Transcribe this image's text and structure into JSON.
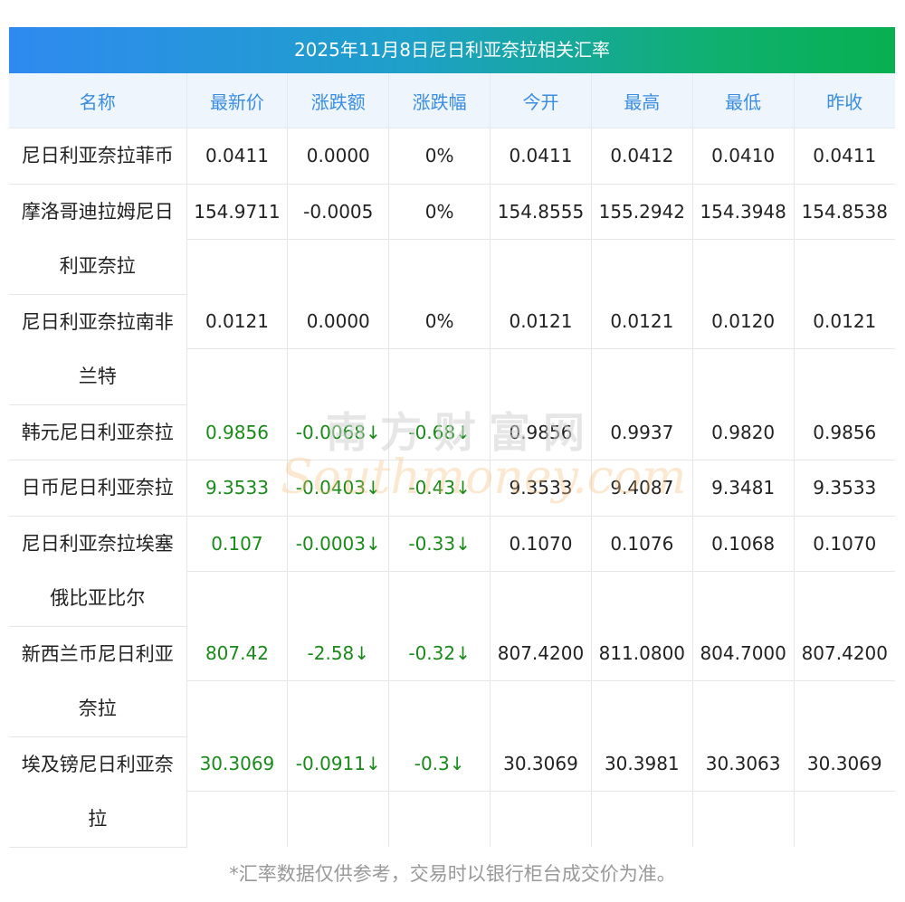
{
  "title": "2025年11月8日尼日利亚奈拉相关汇率",
  "headers": [
    "名称",
    "最新价",
    "涨跌额",
    "涨跌幅",
    "今开",
    "最高",
    "最低",
    "昨收"
  ],
  "rows": [
    {
      "name": "尼日利亚奈拉菲币",
      "latest": "0.0411",
      "change": "0.0000",
      "pct": "0%",
      "open": "0.0411",
      "high": "0.0412",
      "low": "0.0410",
      "prev": "0.0411",
      "green": false,
      "tall": false
    },
    {
      "name": "摩洛哥迪拉姆尼日利亚奈拉",
      "latest": "154.9711",
      "change": "-0.0005",
      "pct": "0%",
      "open": "154.8555",
      "high": "155.2942",
      "low": "154.3948",
      "prev": "154.8538",
      "green": false,
      "tall": true
    },
    {
      "name": "尼日利亚奈拉南非兰特",
      "latest": "0.0121",
      "change": "0.0000",
      "pct": "0%",
      "open": "0.0121",
      "high": "0.0121",
      "low": "0.0120",
      "prev": "0.0121",
      "green": false,
      "tall": true
    },
    {
      "name": "韩元尼日利亚奈拉",
      "latest": "0.9856",
      "change": "-0.0068↓",
      "pct": "-0.68↓",
      "open": "0.9856",
      "high": "0.9937",
      "low": "0.9820",
      "prev": "0.9856",
      "green": true,
      "tall": false
    },
    {
      "name": "日币尼日利亚奈拉",
      "latest": "9.3533",
      "change": "-0.0403↓",
      "pct": "-0.43↓",
      "open": "9.3533",
      "high": "9.4087",
      "low": "9.3481",
      "prev": "9.3533",
      "green": true,
      "tall": false
    },
    {
      "name": "尼日利亚奈拉埃塞俄比亚比尔",
      "latest": "0.107",
      "change": "-0.0003↓",
      "pct": "-0.33↓",
      "open": "0.1070",
      "high": "0.1076",
      "low": "0.1068",
      "prev": "0.1070",
      "green": true,
      "tall": true
    },
    {
      "name": "新西兰币尼日利亚奈拉",
      "latest": "807.42",
      "change": "-2.58↓",
      "pct": "-0.32↓",
      "open": "807.4200",
      "high": "811.0800",
      "low": "804.7000",
      "prev": "807.4200",
      "green": true,
      "tall": true
    },
    {
      "name": "埃及镑尼日利亚奈拉",
      "latest": "30.3069",
      "change": "-0.0911↓",
      "pct": "-0.3↓",
      "open": "30.3069",
      "high": "30.3981",
      "low": "30.3063",
      "prev": "30.3069",
      "green": true,
      "tall": true
    }
  ],
  "watermark": {
    "cn": "南方财富网",
    "en": "Southmoney.com"
  },
  "footnote": "*汇率数据仅供参考，交易时以银行柜台成交价为准。",
  "colors": {
    "header_text": "#3a8de0",
    "header_bg": "#eef5fc",
    "down": "#1a8a1a",
    "title_grad_start": "#2f8af0",
    "title_grad_end": "#08b050"
  }
}
